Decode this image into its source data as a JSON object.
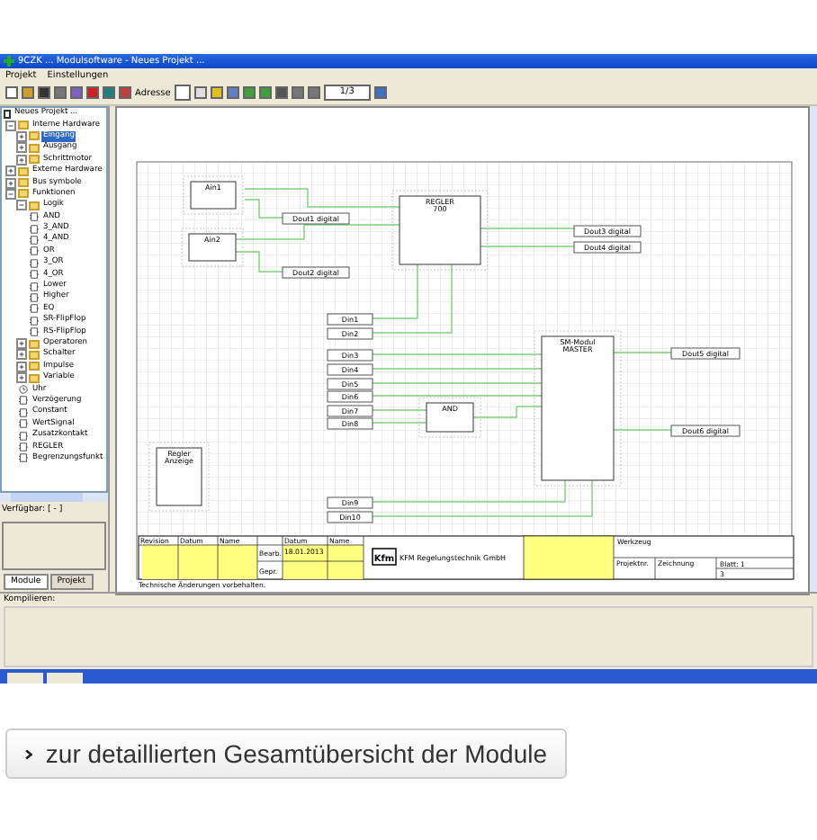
{
  "window": {
    "title": "9CZK ... Modulsoftware - Neues Projekt ..."
  },
  "menu": [
    "Projekt",
    "Einstellungen"
  ],
  "toolbar": {
    "address_label": "Adresse",
    "page": "1/3"
  },
  "tree": {
    "root": "Neues Projekt ...",
    "items": [
      {
        "label": "Interne Hardware",
        "kind": "folder",
        "expanded": true,
        "selected": false,
        "children": [
          {
            "label": "Eingang",
            "kind": "folder",
            "expanded": false,
            "selected": true
          },
          {
            "label": "Ausgang",
            "kind": "folder",
            "expanded": false,
            "selected": false
          },
          {
            "label": "Schrittmotor",
            "kind": "folder",
            "expanded": false,
            "selected": false
          }
        ]
      },
      {
        "label": "Externe Hardware",
        "kind": "folder",
        "expanded": false,
        "selected": false
      },
      {
        "label": "Bus symbole",
        "kind": "folder",
        "expanded": false,
        "selected": false
      },
      {
        "label": "Funktionen",
        "kind": "folder",
        "expanded": true,
        "selected": false,
        "children": [
          {
            "label": "Logik",
            "kind": "folder",
            "expanded": true,
            "selected": false,
            "children": [
              {
                "label": "AND",
                "kind": "gate",
                "selected": false
              },
              {
                "label": "3_AND",
                "kind": "gate",
                "selected": false
              },
              {
                "label": "4_AND",
                "kind": "gate",
                "selected": false
              },
              {
                "label": "OR",
                "kind": "gate",
                "selected": false
              },
              {
                "label": "3_OR",
                "kind": "gate",
                "selected": false
              },
              {
                "label": "4_OR",
                "kind": "gate",
                "selected": false
              },
              {
                "label": "Lower",
                "kind": "gate",
                "selected": false
              },
              {
                "label": "Higher",
                "kind": "gate",
                "selected": false
              },
              {
                "label": "EQ",
                "kind": "gate",
                "selected": false
              },
              {
                "label": "SR-FlipFlop",
                "kind": "gate",
                "selected": false
              },
              {
                "label": "RS-FlipFlop",
                "kind": "gate",
                "selected": false
              }
            ]
          },
          {
            "label": "Operatoren",
            "kind": "folder",
            "expanded": false,
            "selected": false
          },
          {
            "label": "Schalter",
            "kind": "folder",
            "expanded": false,
            "selected": false
          },
          {
            "label": "Impulse",
            "kind": "folder",
            "expanded": false,
            "selected": false
          },
          {
            "label": "Variable",
            "kind": "folder",
            "expanded": false,
            "selected": false
          },
          {
            "label": "Uhr",
            "kind": "clock",
            "selected": false
          },
          {
            "label": "Verzögerung",
            "kind": "gate",
            "selected": false
          },
          {
            "label": "Constant",
            "kind": "gate",
            "selected": false
          },
          {
            "label": "WertSignal",
            "kind": "gate",
            "selected": false
          },
          {
            "label": "Zusatzkontakt",
            "kind": "gate",
            "selected": false
          },
          {
            "label": "REGLER",
            "kind": "gate",
            "selected": false
          },
          {
            "label": "Begrenzungsfunkt",
            "kind": "gate",
            "selected": false
          }
        ]
      }
    ]
  },
  "available": "Verfügbar: [ - ]",
  "panel_tabs": [
    {
      "label": "Module",
      "selected": true
    },
    {
      "label": "Projekt",
      "selected": false
    }
  ],
  "diagram": {
    "blocks": [
      {
        "kind": "module",
        "lines": [
          "Ain1"
        ]
      },
      {
        "kind": "module",
        "lines": [
          "Ain2"
        ]
      },
      {
        "kind": "signal",
        "lines": [
          "Dout1 digital"
        ]
      },
      {
        "kind": "signal",
        "lines": [
          "Dout2 digital"
        ]
      },
      {
        "kind": "module",
        "lines": [
          "REGLER",
          "700"
        ]
      },
      {
        "kind": "signal",
        "lines": [
          "Dout3 digital"
        ]
      },
      {
        "kind": "signal",
        "lines": [
          "Dout4 digital"
        ]
      },
      {
        "kind": "signal",
        "lines": [
          "Din1"
        ]
      },
      {
        "kind": "signal",
        "lines": [
          "Din2"
        ]
      },
      {
        "kind": "signal",
        "lines": [
          "Din3"
        ]
      },
      {
        "kind": "signal",
        "lines": [
          "Din4"
        ]
      },
      {
        "kind": "signal",
        "lines": [
          "Din5"
        ]
      },
      {
        "kind": "signal",
        "lines": [
          "Din6"
        ]
      },
      {
        "kind": "signal",
        "lines": [
          "Din7"
        ]
      },
      {
        "kind": "signal",
        "lines": [
          "Din8"
        ]
      },
      {
        "kind": "module",
        "lines": [
          "AND"
        ]
      },
      {
        "kind": "module",
        "lines": [
          "SM-Modul",
          "MASTER"
        ]
      },
      {
        "kind": "signal",
        "lines": [
          "Dout5 digital"
        ]
      },
      {
        "kind": "signal",
        "lines": [
          "Dout6 digital"
        ]
      },
      {
        "kind": "module",
        "lines": [
          "Regler",
          "Anzeige"
        ]
      },
      {
        "kind": "signal",
        "lines": [
          "Din9"
        ]
      },
      {
        "kind": "signal",
        "lines": [
          "Din10"
        ]
      }
    ]
  },
  "title_block": {
    "headers": [
      "Revision",
      "Datum",
      "Name"
    ],
    "rows": [
      "Bearb.",
      "Gepr."
    ],
    "date_header": "Datum",
    "name_header": "Name",
    "date": "18.01.2013",
    "logo": "Kfm",
    "company": "KFM Regelungstechnik GmbH",
    "tool": "Werkzeug",
    "project": "Projektnr.",
    "drawing": "Zeichnung",
    "sheet": "Blatt: 1",
    "sheet_count": "3",
    "note": "Technische Änderungen vorbehalten."
  },
  "output": {
    "label": "Kompilieren:"
  },
  "link_button": {
    "label": "zur detaillierten Gesamtübersicht der Module"
  }
}
